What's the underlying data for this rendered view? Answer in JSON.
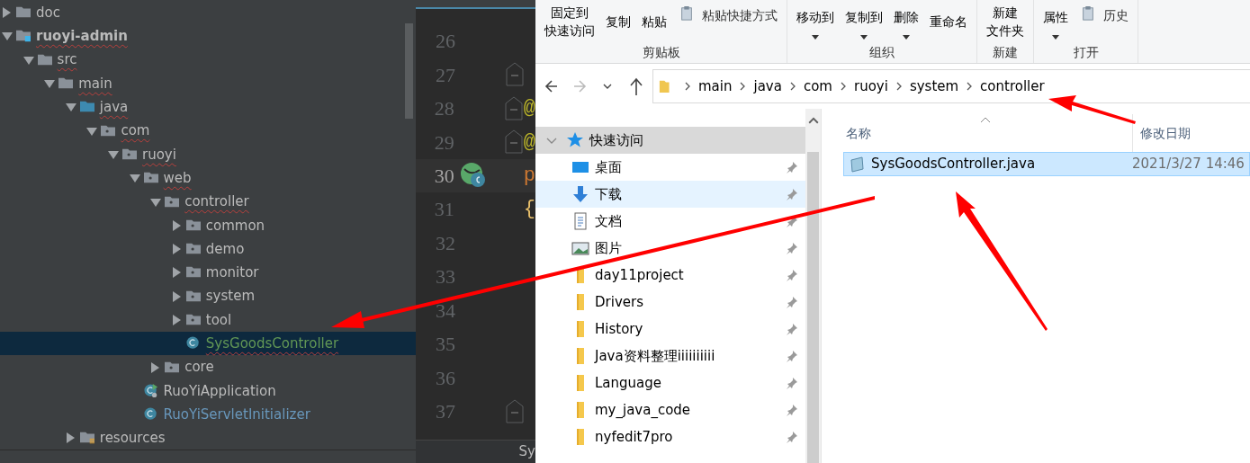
{
  "project_tree": [
    {
      "label": "doc",
      "kind": "folder",
      "expanded": false,
      "error": false,
      "selected": false
    },
    {
      "label": "ruoyi-admin",
      "kind": "module",
      "expanded": true,
      "error": true,
      "selected": false,
      "children": [
        {
          "label": "src",
          "kind": "folder",
          "expanded": true,
          "error": true,
          "selected": false,
          "children": [
            {
              "label": "main",
              "kind": "folder",
              "expanded": true,
              "error": true,
              "selected": false,
              "children": [
                {
                  "label": "java",
                  "kind": "source",
                  "expanded": true,
                  "error": true,
                  "selected": false,
                  "children": [
                    {
                      "label": "com",
                      "kind": "package",
                      "expanded": true,
                      "error": true,
                      "selected": false,
                      "children": [
                        {
                          "label": "ruoyi",
                          "kind": "package",
                          "expanded": true,
                          "error": true,
                          "selected": false,
                          "children": [
                            {
                              "label": "web",
                              "kind": "package",
                              "expanded": true,
                              "error": true,
                              "selected": false,
                              "children": [
                                {
                                  "label": "controller",
                                  "kind": "package",
                                  "expanded": true,
                                  "error": true,
                                  "selected": false,
                                  "children": [
                                    {
                                      "label": "common",
                                      "kind": "package",
                                      "expanded": false,
                                      "error": false,
                                      "selected": false
                                    },
                                    {
                                      "label": "demo",
                                      "kind": "package",
                                      "expanded": false,
                                      "error": false,
                                      "selected": false
                                    },
                                    {
                                      "label": "monitor",
                                      "kind": "package",
                                      "expanded": false,
                                      "error": false,
                                      "selected": false
                                    },
                                    {
                                      "label": "system",
                                      "kind": "package",
                                      "expanded": false,
                                      "error": false,
                                      "selected": false
                                    },
                                    {
                                      "label": "tool",
                                      "kind": "package",
                                      "expanded": false,
                                      "error": false,
                                      "selected": false
                                    },
                                    {
                                      "label": "SysGoodsController",
                                      "kind": "class",
                                      "color": "#629755",
                                      "error": true,
                                      "selected": true
                                    }
                                  ]
                                },
                                {
                                  "label": "core",
                                  "kind": "package",
                                  "expanded": false,
                                  "error": false,
                                  "selected": false
                                }
                              ]
                            },
                            {
                              "label": "RuoYiApplication",
                              "kind": "app-class",
                              "error": false,
                              "selected": false
                            },
                            {
                              "label": "RuoYiServletInitializer",
                              "kind": "class",
                              "color": "#6897bb",
                              "error": false,
                              "selected": false
                            }
                          ]
                        }
                      ]
                    }
                  ]
                },
                {
                  "label": "resources",
                  "kind": "resources",
                  "expanded": false,
                  "error": false,
                  "selected": false
                }
              ]
            }
          ]
        }
      ]
    }
  ],
  "editor": {
    "lines": [
      {
        "number": "26",
        "current": false,
        "fold": false
      },
      {
        "number": "27",
        "current": false,
        "fold": true
      },
      {
        "number": "28",
        "current": false,
        "fold": true,
        "code": "@",
        "color": "#bbb529"
      },
      {
        "number": "29",
        "current": false,
        "fold": true,
        "code": "@",
        "color": "#bbb529"
      },
      {
        "number": "30",
        "current": true,
        "fold": false,
        "code": "p",
        "color": "#cc7832",
        "gutter_icon": true
      },
      {
        "number": "31",
        "current": false,
        "fold": false,
        "code": "{",
        "color": "#e8bf6a"
      },
      {
        "number": "32",
        "current": false,
        "fold": false
      },
      {
        "number": "33",
        "current": false,
        "fold": false
      },
      {
        "number": "34",
        "current": false,
        "fold": false
      },
      {
        "number": "35",
        "current": false,
        "fold": false
      },
      {
        "number": "36",
        "current": false,
        "fold": false
      },
      {
        "number": "37",
        "current": false,
        "fold": true
      }
    ],
    "breadcrumb": "Sy"
  },
  "explorer": {
    "ribbon_groups": [
      {
        "label": "剪贴板",
        "buttons": [
          {
            "lines": [
              "固定到",
              "快速访问"
            ],
            "kind": "large"
          },
          {
            "lines": [
              "复制"
            ],
            "kind": "large"
          },
          {
            "lines": [
              "粘贴"
            ],
            "kind": "large"
          },
          {
            "lines": [
              "粘贴快捷方式"
            ],
            "kind": "small"
          }
        ]
      },
      {
        "label": "组织",
        "buttons": [
          {
            "lines": [
              "移动到"
            ],
            "kind": "dropdown"
          },
          {
            "lines": [
              "复制到"
            ],
            "kind": "dropdown"
          },
          {
            "lines": [
              "删除"
            ],
            "kind": "dropdown"
          },
          {
            "lines": [
              "重命名"
            ],
            "kind": "large"
          }
        ]
      },
      {
        "label": "新建",
        "buttons": [
          {
            "lines": [
              "新建",
              "文件夹"
            ],
            "kind": "large"
          }
        ]
      },
      {
        "label": "打开",
        "buttons": [
          {
            "lines": [
              "属性"
            ],
            "kind": "dropdown"
          },
          {
            "lines": [
              "历史"
            ],
            "kind": "small"
          }
        ]
      }
    ],
    "address": [
      "main",
      "java",
      "com",
      "ruoyi",
      "system",
      "controller"
    ],
    "nav": [
      {
        "label": "快速访问",
        "kind": "header",
        "expanded": true,
        "hover": false
      },
      {
        "label": "桌面",
        "kind": "desktop",
        "hover": false
      },
      {
        "label": "下载",
        "kind": "download",
        "hover": true
      },
      {
        "label": "文档",
        "kind": "document",
        "hover": false
      },
      {
        "label": "图片",
        "kind": "picture",
        "hover": false
      },
      {
        "label": "day11project",
        "kind": "folder",
        "hover": false
      },
      {
        "label": "Drivers",
        "kind": "folder",
        "hover": false
      },
      {
        "label": "History",
        "kind": "folder",
        "hover": false
      },
      {
        "label": "Java资料整理iiiiiiiiii",
        "kind": "folder",
        "hover": false
      },
      {
        "label": "Language",
        "kind": "folder",
        "hover": false
      },
      {
        "label": "my_java_code",
        "kind": "folder",
        "hover": false
      },
      {
        "label": "nyfedit7pro",
        "kind": "folder",
        "hover": false
      }
    ],
    "columns": [
      "名称",
      "修改日期"
    ],
    "files": [
      {
        "name": "SysGoodsController.java",
        "modified": "2021/3/27 14:46",
        "selected": true
      }
    ]
  }
}
